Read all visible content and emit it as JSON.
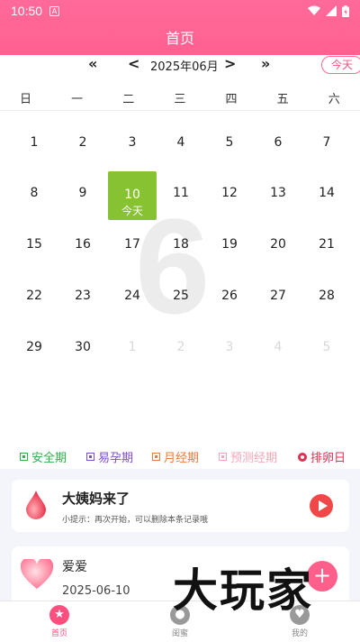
{
  "status_bar": {
    "time": "10:50",
    "app_icon": "A"
  },
  "header": {
    "title": "首页"
  },
  "month_nav": {
    "prev_year": "«",
    "prev_month": "<",
    "month_label": "2025年06月",
    "next_month": ">",
    "next_year": "»",
    "today_button": "今天"
  },
  "weekdays": [
    "日",
    "一",
    "二",
    "三",
    "四",
    "五",
    "六"
  ],
  "big_month": "6",
  "calendar": {
    "rows": [
      [
        "1",
        "2",
        "3",
        "4",
        "5",
        "6",
        "7"
      ],
      [
        "8",
        "9",
        "10",
        "11",
        "12",
        "13",
        "14"
      ],
      [
        "15",
        "16",
        "17",
        "18",
        "19",
        "20",
        "21"
      ],
      [
        "22",
        "23",
        "24",
        "25",
        "26",
        "27",
        "28"
      ],
      [
        "29",
        "30",
        "1",
        "2",
        "3",
        "4",
        "5"
      ]
    ],
    "today_sub": "今天"
  },
  "legend": {
    "safe": "安全期",
    "fertile": "易孕期",
    "period": "月经期",
    "predicted": "预测经期",
    "ovulation": "排卵日"
  },
  "colors": {
    "header_pink": "#ff6090",
    "today_green": "#86c232",
    "safe": "#2bb24c",
    "fertile": "#7d4cc9",
    "period": "#f07a3a",
    "predicted": "#f4a6b8",
    "ovulation": "#e03050"
  },
  "period_card": {
    "title": "大姨妈来了",
    "tip": "小提示：再次开始，可以删除本条记录哦"
  },
  "love_card": {
    "title": "爱爱",
    "date": "2025-06-10"
  },
  "watermark": "大玩家",
  "tabs": [
    {
      "label": "首页",
      "icon": "star-icon"
    },
    {
      "label": "闺蜜",
      "icon": "user-icon"
    },
    {
      "label": "我的",
      "icon": "heart-icon"
    }
  ]
}
